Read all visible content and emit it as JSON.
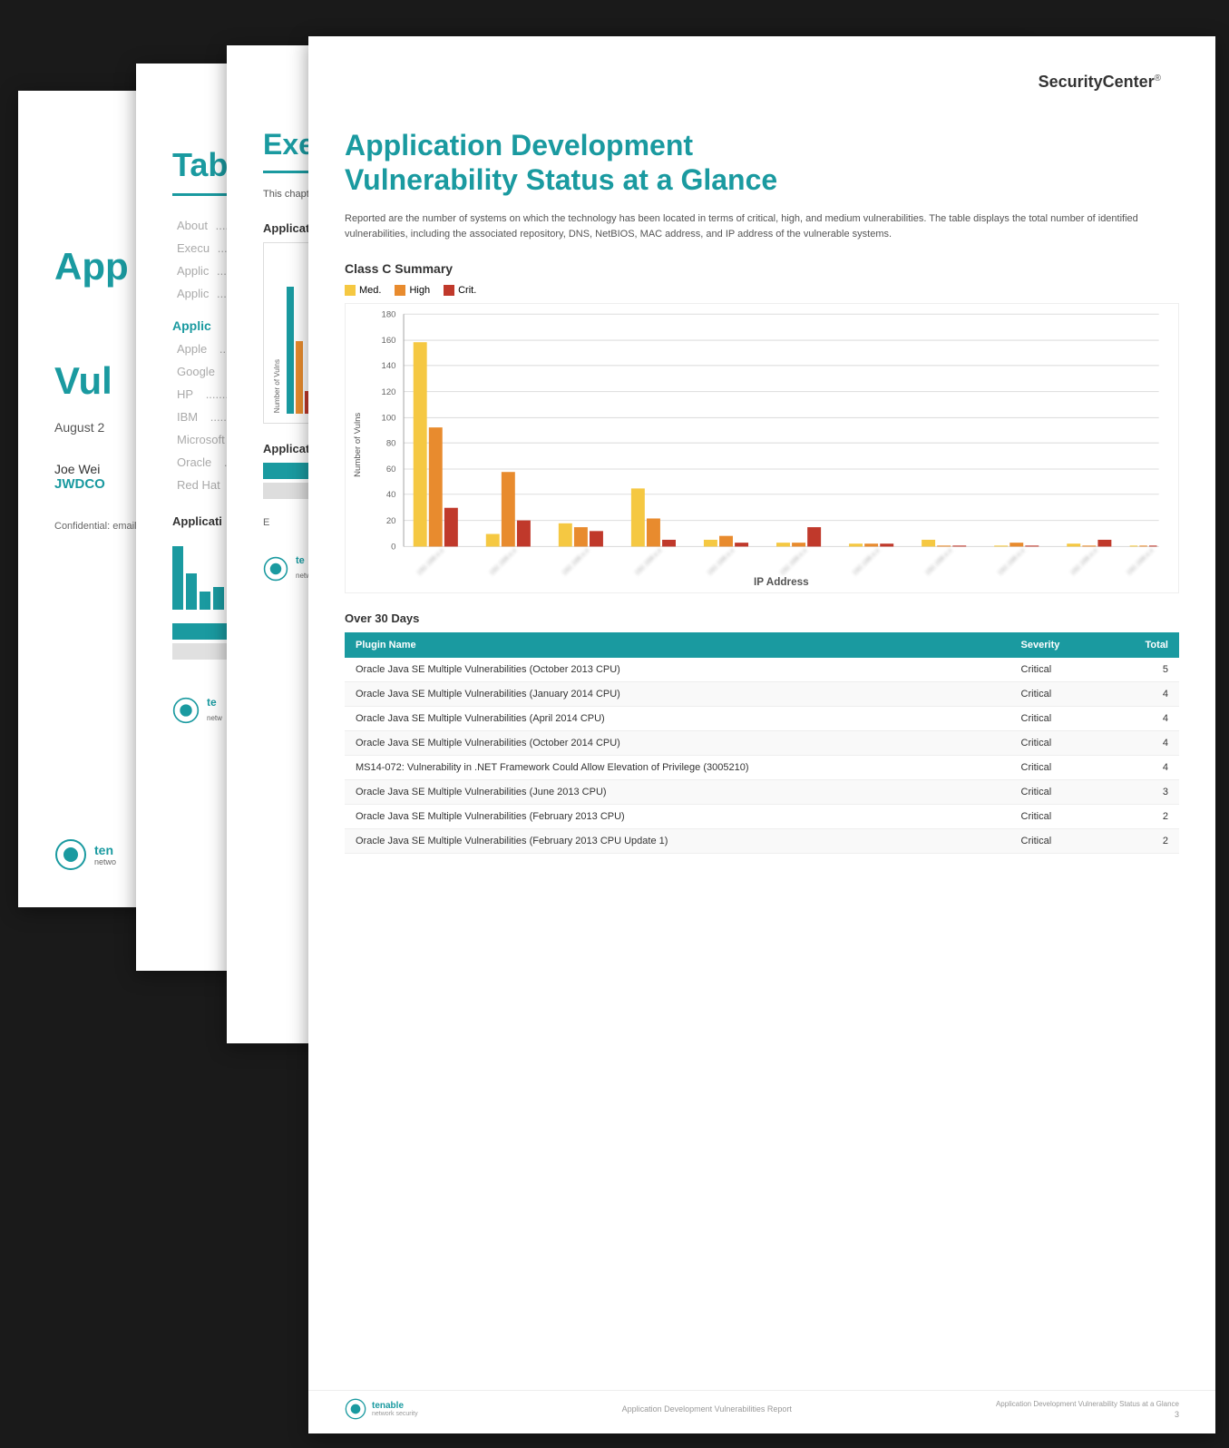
{
  "app": {
    "brand": "SecurityCenter",
    "brand_tm": "®"
  },
  "cover": {
    "title_line1": "App",
    "title_line2": "Vul",
    "full_title_line1": "Application Development",
    "full_title_line2": "Vulnerability Status at a Glance",
    "date": "August 2",
    "author_name": "Joe Wei",
    "author_company": "JWDCO",
    "confidential_text": "Confidential: email, fax, o recipient con saved on pro within this re any of the pr",
    "tenable_text": "ten",
    "tenable_subtext": "netwo"
  },
  "toc": {
    "title": "Table of Contents",
    "items": [
      {
        "label": "About",
        "dots": ""
      },
      {
        "label": "Execu",
        "dots": ""
      },
      {
        "label": "Applic",
        "dots": ""
      },
      {
        "label": "Applic",
        "dots": ""
      },
      {
        "label": "Applic",
        "dots": ""
      }
    ],
    "sub_items": [
      {
        "label": "Apple",
        "dots": "......"
      },
      {
        "label": "Google",
        "dots": "..."
      },
      {
        "label": "HP",
        "dots": "........"
      },
      {
        "label": "IBM",
        "dots": "........"
      },
      {
        "label": "Microsoft",
        "dots": ""
      },
      {
        "label": "Oracle",
        "dots": "...."
      },
      {
        "label": "Red Hat",
        "dots": ".."
      }
    ],
    "chart_section": "Applicati"
  },
  "exec_summary": {
    "title": "Executive Summary",
    "description": "This chapter additional ma patching and"
  },
  "main_page": {
    "title_line1": "Application Development",
    "title_line2": "Vulnerability Status at a Glance",
    "description": "Reported are the number of systems on which the technology has been located in terms of critical, high, and medium vulnerabilities. The table displays the total number of identified vulnerabilities, including the associated repository, DNS, NetBIOS, MAC address, and IP address of the vulnerable systems.",
    "chart_title": "Class C Summary",
    "chart_legend": {
      "med_label": "Med.",
      "high_label": "High",
      "crit_label": "Crit.",
      "med_color": "#f5c842",
      "high_color": "#e88b2e",
      "crit_color": "#c0392b"
    },
    "chart_y_label": "Number of Vulns",
    "chart_x_label": "IP Address",
    "chart_y_max": 180,
    "chart_bars": [
      {
        "med": 158,
        "high": 92,
        "crit": 30
      },
      {
        "med": 10,
        "high": 58,
        "crit": 20
      },
      {
        "med": 18,
        "high": 15,
        "crit": 12
      },
      {
        "med": 45,
        "high": 22,
        "crit": 5
      },
      {
        "med": 5,
        "high": 8,
        "crit": 3
      },
      {
        "med": 3,
        "high": 3,
        "crit": 15
      },
      {
        "med": 2,
        "high": 2,
        "crit": 2
      },
      {
        "med": 5,
        "high": 1,
        "crit": 1
      },
      {
        "med": 1,
        "high": 3,
        "crit": 1
      },
      {
        "med": 2,
        "high": 1,
        "crit": 5
      },
      {
        "med": 1,
        "high": 1,
        "crit": 1
      }
    ],
    "chart_y_ticks": [
      0,
      20,
      40,
      60,
      80,
      100,
      120,
      140,
      160,
      180
    ],
    "table_section_title": "Over 30 Days",
    "table_headers": [
      "Plugin Name",
      "Severity",
      "Total"
    ],
    "table_rows": [
      {
        "plugin": "Oracle Java SE Multiple Vulnerabilities (October 2013 CPU)",
        "severity": "Critical",
        "total": "5"
      },
      {
        "plugin": "Oracle Java SE Multiple Vulnerabilities (January 2014 CPU)",
        "severity": "Critical",
        "total": "4"
      },
      {
        "plugin": "Oracle Java SE Multiple Vulnerabilities (April 2014 CPU)",
        "severity": "Critical",
        "total": "4"
      },
      {
        "plugin": "Oracle Java SE Multiple Vulnerabilities (October 2014 CPU)",
        "severity": "Critical",
        "total": "4"
      },
      {
        "plugin": "MS14-072: Vulnerability in .NET Framework Could Allow Elevation of Privilege (3005210)",
        "severity": "Critical",
        "total": "4"
      },
      {
        "plugin": "Oracle Java SE Multiple Vulnerabilities (June 2013 CPU)",
        "severity": "Critical",
        "total": "3"
      },
      {
        "plugin": "Oracle Java SE Multiple Vulnerabilities (February 2013 CPU)",
        "severity": "Critical",
        "total": "2"
      },
      {
        "plugin": "Oracle Java SE Multiple Vulnerabilities (February 2013 CPU Update 1)",
        "severity": "Critical",
        "total": "2"
      }
    ],
    "footer_subtitle": "Application Development Vulnerability Status at a Glance",
    "footer_doc_title": "Application Development Vulnerabilities Report",
    "footer_page_num": "3"
  },
  "tenable": {
    "logo_text": "tenable",
    "logo_subtext": "network security"
  }
}
